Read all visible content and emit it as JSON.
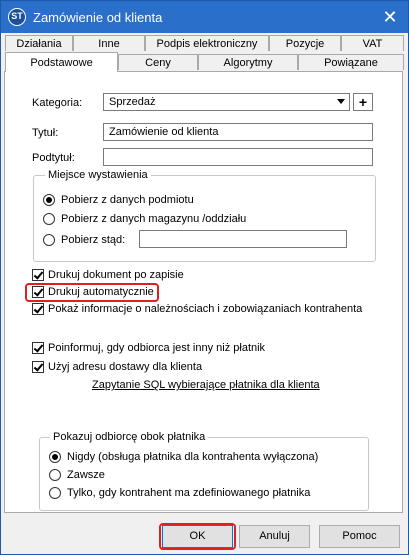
{
  "window": {
    "title": "Zamówienie od klienta",
    "close_glyph": "✕",
    "icon_text": "ST"
  },
  "tabs_row1": [
    "Działania",
    "Inne",
    "Podpis elektroniczny",
    "Pozycje",
    "VAT"
  ],
  "tabs_row2": [
    "Podstawowe",
    "Ceny",
    "Algorytmy",
    "Powiązane"
  ],
  "active_tab": "Podstawowe",
  "form": {
    "kategoria_label": "Kategoria:",
    "kategoria_value": "Sprzedaż",
    "plus_label": "+",
    "tytul_label": "Tytuł:",
    "tytul_value": "Zamówienie od klienta",
    "podtytul_label": "Podtytuł:",
    "podtytul_value": ""
  },
  "miejsce": {
    "legend": "Miejsce wystawienia",
    "options": [
      "Pobierz z danych podmiotu",
      "Pobierz z danych magazynu /oddziału",
      "Pobierz stąd:"
    ],
    "selected": 0,
    "custom_value": ""
  },
  "checks": {
    "drukuj_po_zapisie": {
      "label": "Drukuj dokument po zapisie",
      "checked": true
    },
    "drukuj_auto": {
      "label": "Drukuj automatycznie",
      "checked": true
    },
    "pokaz_info": {
      "label": "Pokaż informacje o należnościach i zobowiązaniach kontrahenta",
      "checked": true
    },
    "poinformuj": {
      "label": "Poinformuj, gdy odbiorca jest inny niż płatnik",
      "checked": true
    },
    "uzyj_adresu": {
      "label": "Użyj adresu dostawy dla klienta",
      "checked": true
    }
  },
  "sql_link": "Zapytanie SQL wybierające płatnika dla klienta",
  "pokazuj": {
    "legend": "Pokazuj odbiorcę obok płatnika",
    "options": [
      "Nigdy (obsługa płatnika dla kontrahenta wyłączona)",
      "Zawsze",
      "Tylko, gdy kontrahent ma zdefiniowanego płatnika"
    ],
    "selected": 0
  },
  "buttons": {
    "ok": "OK",
    "cancel": "Anuluj",
    "help": "Pomoc"
  },
  "colors": {
    "titlebar": "#2a6fc9",
    "highlight": "#e02020"
  }
}
